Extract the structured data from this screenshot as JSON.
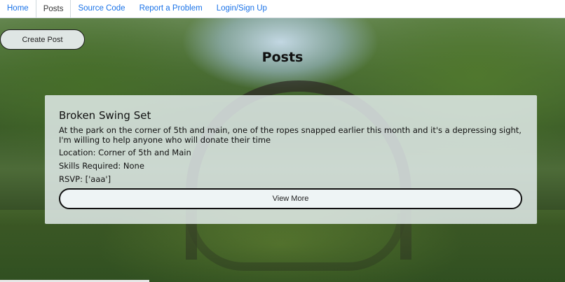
{
  "nav": {
    "tabs": [
      {
        "label": "Home"
      },
      {
        "label": "Posts"
      },
      {
        "label": "Source Code"
      },
      {
        "label": "Report a Problem"
      },
      {
        "label": "Login/Sign Up"
      }
    ],
    "active_index": 1
  },
  "actions": {
    "create_post_label": "Create Post"
  },
  "page": {
    "title": "Posts"
  },
  "post": {
    "title": "Broken Swing Set",
    "description": "At the park on the corner of 5th and main, one of the ropes snapped earlier this month and it's a depressing sight, I'm willing to help anyone who will donate their time",
    "location": "Location: Corner of 5th and Main",
    "skills": "Skills Required: None",
    "rsvp": "RSVP: ['aaa']",
    "view_more_label": "View More"
  },
  "colors": {
    "link": "#1a73e8",
    "card_bg": "#e8f0f2",
    "button_border": "#111111"
  }
}
